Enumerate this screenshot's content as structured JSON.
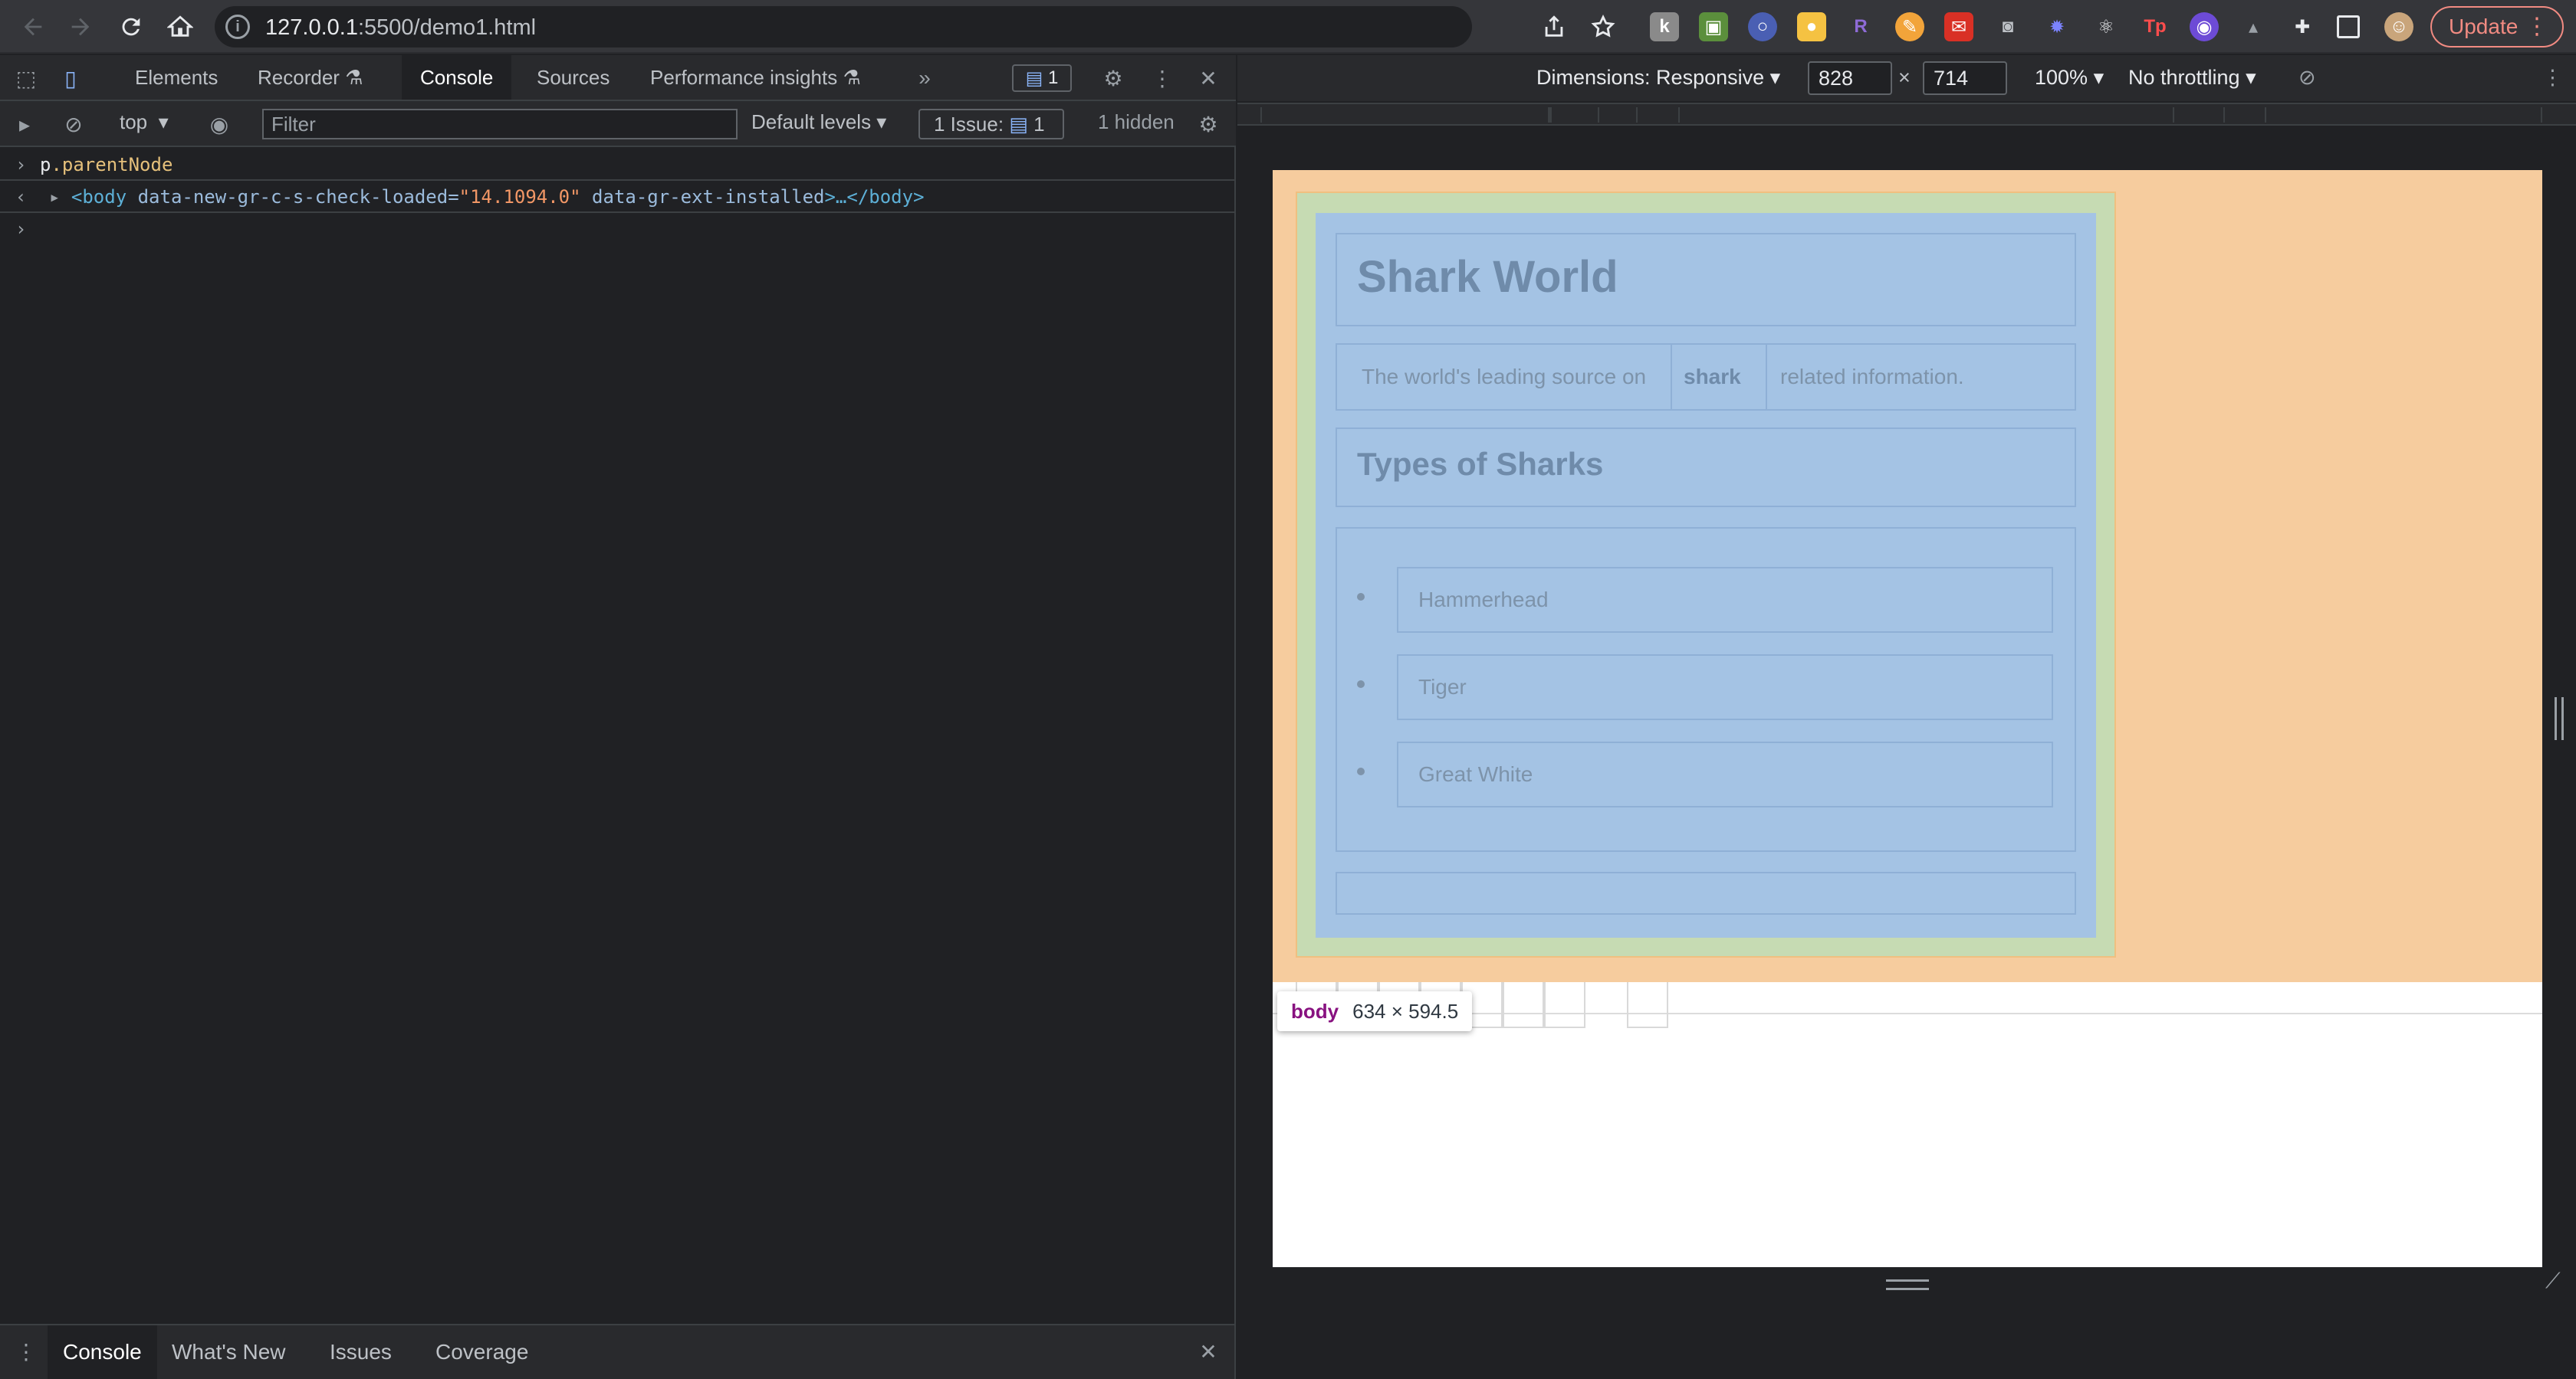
{
  "browser": {
    "url_host": "127.0.0.1",
    "url_rest": ":5500/demo1.html",
    "update_label": "Update"
  },
  "devtools": {
    "tabs": [
      "Elements",
      "Recorder",
      "Console",
      "Sources",
      "Performance insights"
    ],
    "active_tab": "Console",
    "issues_badge": "1",
    "toolbar": {
      "context": "top",
      "filter_placeholder": "Filter",
      "levels": "Default levels",
      "issue_label": "1 Issue:",
      "issue_count": "1",
      "hidden": "1 hidden"
    },
    "console": {
      "input_expr_var": "p",
      "input_expr_prop": ".parentNode",
      "result_tag_open": "<body",
      "result_attr1_name": "data-new-gr-c-s-check-loaded=",
      "result_attr1_val": "\"14.1094.0\"",
      "result_attr2_name": "data-gr-ext-installed",
      "result_tag_close": ">…</body>"
    },
    "drawer_tabs": [
      "Console",
      "What's New",
      "Issues",
      "Coverage"
    ]
  },
  "device": {
    "dimensions_label": "Dimensions: Responsive",
    "width": "828",
    "times": "×",
    "height": "714",
    "zoom": "100%",
    "throttling": "No throttling"
  },
  "page": {
    "title": "Shark World",
    "intro_before": "The world's leading source on",
    "intro_strong": "shark",
    "intro_after": "related information.",
    "subtitle": "Types of Sharks",
    "sharks": [
      "Hammerhead",
      "Tiger",
      "Great White"
    ]
  },
  "tooltip": {
    "tag": "body",
    "dims": "634 × 594.5"
  },
  "colors": {
    "margin_highlight": "#f6cc9e",
    "border_highlight": "#c6dbb3",
    "content_highlight": "#a4c3e4",
    "update_accent": "#f28b82"
  }
}
